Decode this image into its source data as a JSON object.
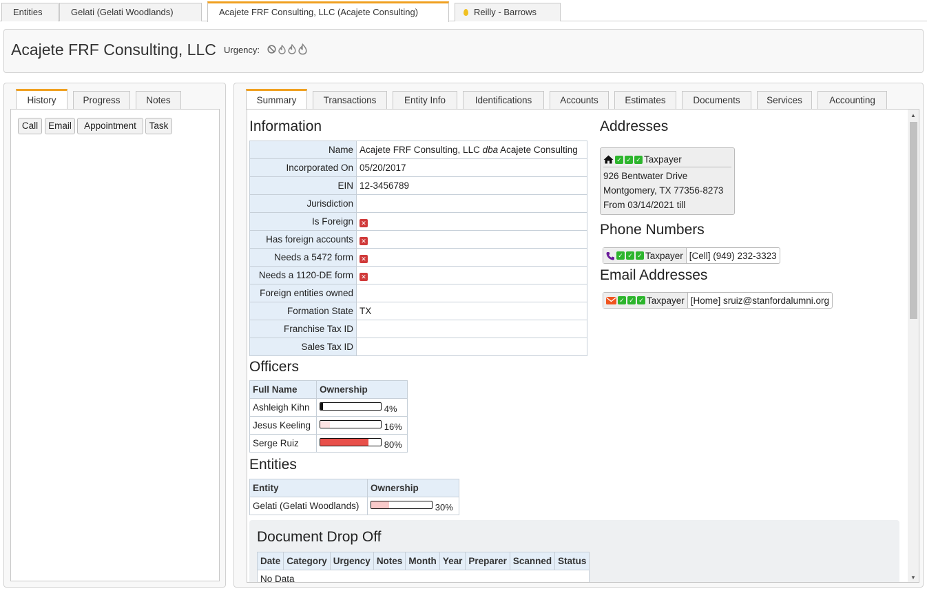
{
  "top_tabs": [
    {
      "label": "Entities"
    },
    {
      "label": "Gelati (Gelati Woodlands)"
    },
    {
      "label": "Acajete FRF Consulting, LLC (Acajete Consulting)"
    },
    {
      "label": "Reilly - Barrows"
    }
  ],
  "header": {
    "title": "Acajete FRF Consulting, LLC",
    "urgency_label": "Urgency:",
    "urgency_icons": [
      "ban-icon",
      "flame-icon",
      "flame-icon",
      "flame-icon"
    ]
  },
  "left": {
    "tabs": [
      "History",
      "Progress",
      "Notes"
    ],
    "actions": [
      "Call",
      "Email",
      "Appointment",
      "Task"
    ]
  },
  "right": {
    "tabs": [
      "Summary",
      "Transactions",
      "Entity Info",
      "Identifications",
      "Accounts",
      "Estimates",
      "Documents",
      "Services",
      "Accounting"
    ]
  },
  "information": {
    "heading": "Information",
    "name_company": "Acajete FRF Consulting, LLC",
    "name_dba": "dba",
    "name_trade": "Acajete Consulting",
    "rows": [
      {
        "label": "Name",
        "value": ""
      },
      {
        "label": "Incorporated On",
        "value": "05/20/2017"
      },
      {
        "label": "EIN",
        "value": "12-3456789"
      },
      {
        "label": "Jurisdiction",
        "value": ""
      },
      {
        "label": "Is Foreign",
        "value": ""
      },
      {
        "label": "Has foreign accounts",
        "value": ""
      },
      {
        "label": "Needs a 5472 form",
        "value": ""
      },
      {
        "label": "Needs a 1120-DE form",
        "value": ""
      },
      {
        "label": "Foreign entities owned",
        "value": ""
      },
      {
        "label": "Formation State",
        "value": "TX"
      },
      {
        "label": "Franchise Tax ID",
        "value": ""
      },
      {
        "label": "Sales Tax ID",
        "value": ""
      }
    ]
  },
  "officers": {
    "heading": "Officers",
    "columns": [
      "Full Name",
      "Ownership"
    ],
    "rows": [
      {
        "name": "Ashleigh Kihn",
        "ownership": 4,
        "pct": "4%",
        "color": "#111111"
      },
      {
        "name": "Jesus Keeling",
        "ownership": 16,
        "pct": "16%",
        "color": "#fde3e3"
      },
      {
        "name": "Serge Ruiz",
        "ownership": 80,
        "pct": "80%",
        "color": "#e8504a"
      }
    ]
  },
  "entities": {
    "heading": "Entities",
    "columns": [
      "Entity",
      "Ownership"
    ],
    "rows": [
      {
        "name": "Gelati (Gelati Woodlands)",
        "ownership": 30,
        "pct": "30%",
        "color": "#f8c9c9"
      }
    ]
  },
  "addresses": {
    "heading": "Addresses",
    "type": "Taxpayer",
    "line1": "926 Bentwater Drive",
    "line2": "Montgomery, TX 77356-8273",
    "line3": "From 03/14/2021 till"
  },
  "phones": {
    "heading": "Phone Numbers",
    "type": "Taxpayer",
    "value": "[Cell] (949) 232-3323"
  },
  "emails": {
    "heading": "Email Addresses",
    "type": "Taxpayer",
    "value": "[Home] sruiz@stanfordalumni.org"
  },
  "drop_off": {
    "heading": "Document Drop Off",
    "columns": [
      "Date",
      "Category",
      "Urgency",
      "Notes",
      "Month",
      "Year",
      "Preparer",
      "Scanned",
      "Status"
    ],
    "empty": "No Data"
  },
  "colors": {
    "accent": "#f0a020",
    "check": "#2db52d",
    "cross": "#d03a3a",
    "header_cell": "#e4eef8"
  }
}
